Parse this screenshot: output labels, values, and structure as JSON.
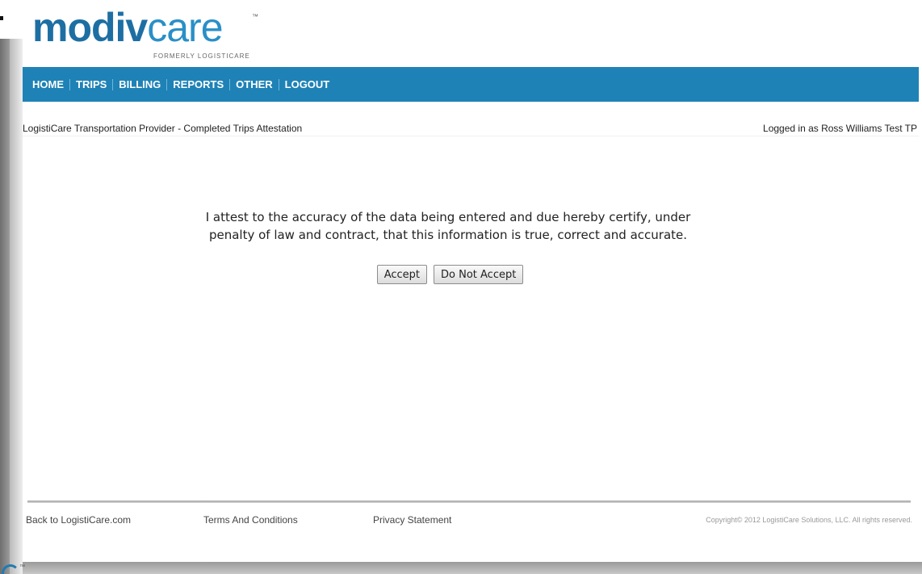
{
  "logo": {
    "bold": "modiv",
    "light": "care",
    "tm": "™",
    "subtitle": "FORMERLY LOGISTICARE"
  },
  "nav": {
    "items": [
      "HOME",
      "TRIPS",
      "BILLING",
      "REPORTS",
      "OTHER",
      "LOGOUT"
    ]
  },
  "header": {
    "title": "LogistiCare Transportation Provider - Completed Trips Attestation",
    "logged_in": "Logged in as Ross Williams Test TP"
  },
  "attestation": {
    "line1": "I attest to the accuracy of the data being entered and due hereby certify, under",
    "line2": "penalty of law and contract, that this information is true, correct and accurate.",
    "accept_label": "Accept",
    "decline_label": "Do Not Accept"
  },
  "footer": {
    "back_link": "Back to LogistiCare.com",
    "terms_link": "Terms And Conditions",
    "privacy_link": "Privacy Statement",
    "copyright": "Copyright© 2012 LogistiCare Solutions, LLC. All rights reserved."
  },
  "colors": {
    "brand_dark": "#1d6fa3",
    "brand_light": "#2a8fc7",
    "nav_bg": "#1f82b6"
  }
}
